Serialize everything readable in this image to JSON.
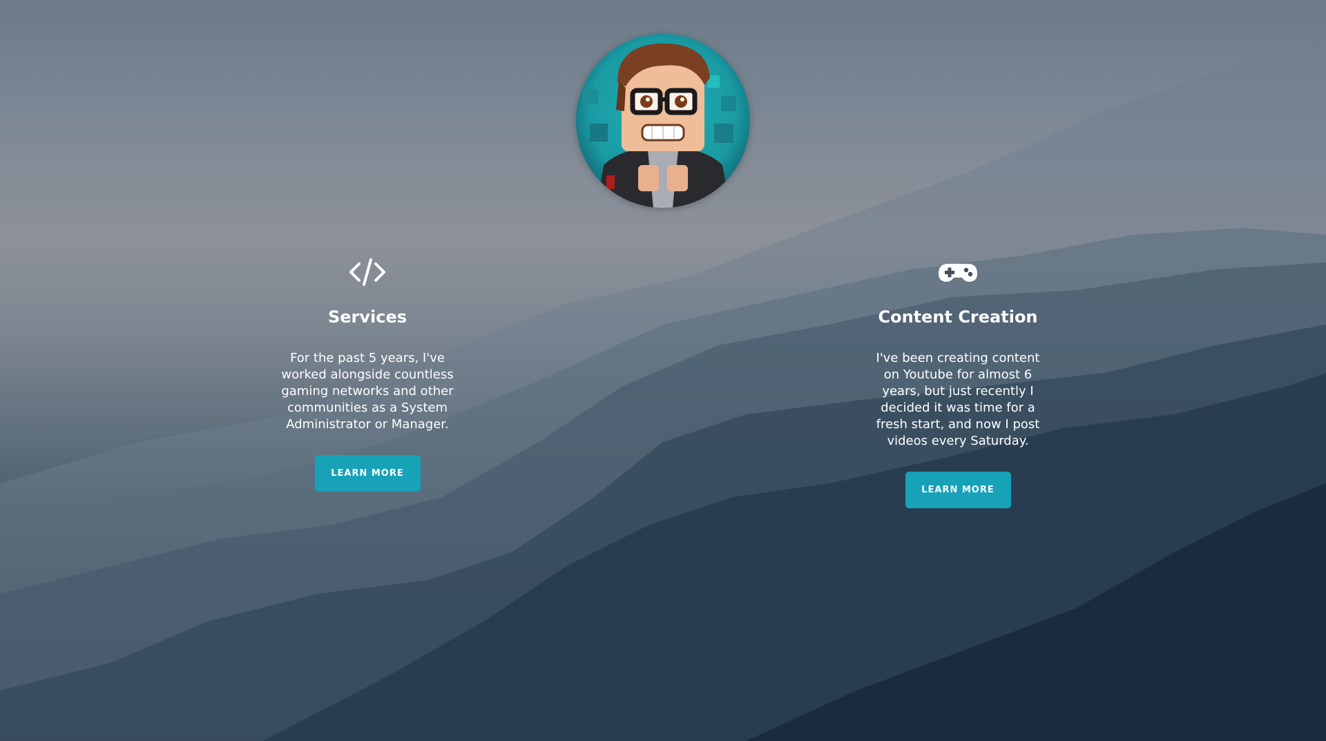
{
  "theme": {
    "accent": "#17a2b8",
    "text": "#ffffff",
    "avatar_ring": "#2ec4c4"
  },
  "avatar": {
    "icon": "avatar-cartoon-man-glasses"
  },
  "columns": [
    {
      "icon": "code-icon",
      "title": "Services",
      "text": "For the past 5 years, I've worked alongside countless gaming networks and other communities as a System Administrator or Manager.",
      "button": "LEARN MORE"
    },
    {
      "icon": "gamepad-icon",
      "title": "Content Creation",
      "text": "I've been creating content on Youtube for almost 6 years, but just recently I decided it was time for a fresh start, and now I post videos every Saturday.",
      "button": "LEARN MORE"
    }
  ]
}
